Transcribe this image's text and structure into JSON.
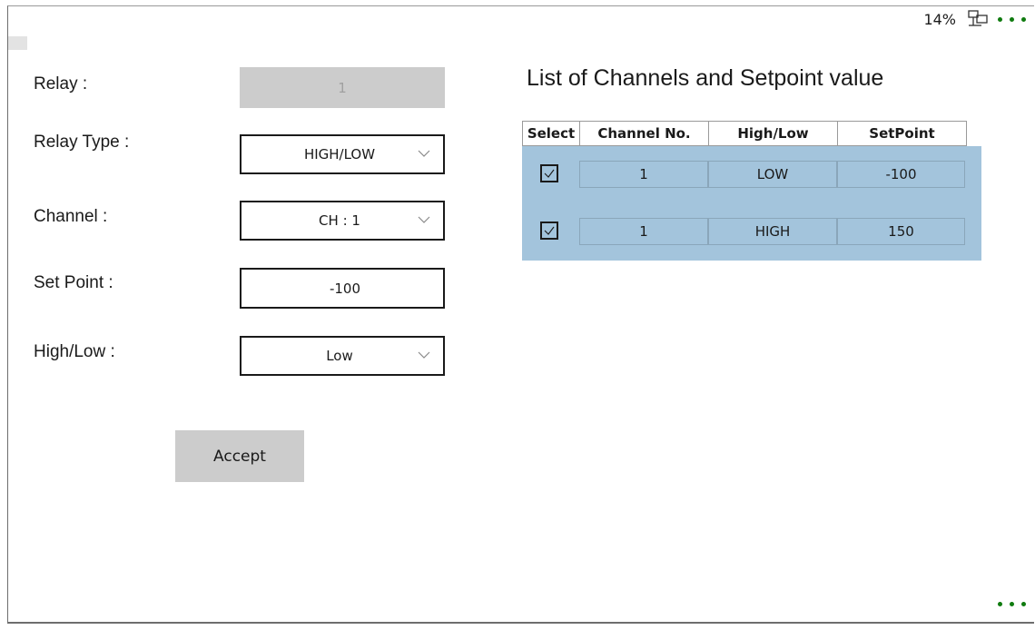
{
  "status": {
    "battery_percent": "14%",
    "network_icon": "network-wired-icon",
    "more_icon": "more-dots-icon",
    "accent_color": "#0f7b0f"
  },
  "form": {
    "relay": {
      "label": "Relay :",
      "value": "1"
    },
    "relay_type": {
      "label": "Relay Type :",
      "value": "HIGH/LOW"
    },
    "channel": {
      "label": "Channel :",
      "value": "CH : 1"
    },
    "set_point": {
      "label": "Set Point :",
      "value": "-100"
    },
    "high_low": {
      "label": "High/Low :",
      "value": "Low"
    },
    "accept_label": "Accept"
  },
  "list": {
    "title": "List of Channels and Setpoint value",
    "columns": [
      "Select",
      "Channel No.",
      "High/Low",
      "SetPoint"
    ],
    "rows": [
      {
        "selected": true,
        "channel": "1",
        "high_low": "LOW",
        "setpoint": "-100"
      },
      {
        "selected": true,
        "channel": "1",
        "high_low": "HIGH",
        "setpoint": "150"
      }
    ],
    "body_color": "#a3c4dc"
  }
}
